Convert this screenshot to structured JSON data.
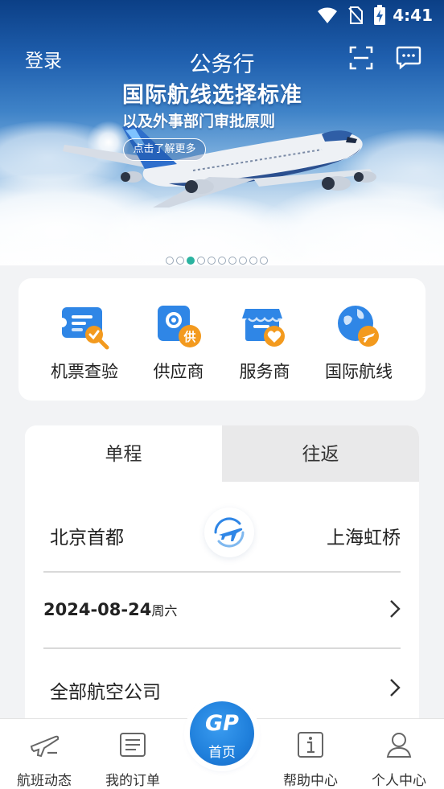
{
  "status_bar": {
    "time": "4:41"
  },
  "header": {
    "login_label": "登录",
    "title": "公务行"
  },
  "banner": {
    "title": "国际航线选择标准",
    "subtitle": "以及外事部门审批原则",
    "cta_label": "点击了解更多",
    "carousel_total": 10,
    "carousel_active_index": 2
  },
  "quick_services": [
    {
      "label": "机票查验",
      "icon": "ticket-verify-icon"
    },
    {
      "label": "供应商",
      "icon": "supplier-icon",
      "badge": "供"
    },
    {
      "label": "服务商",
      "icon": "service-provider-icon"
    },
    {
      "label": "国际航线",
      "icon": "international-route-icon"
    }
  ],
  "booking": {
    "tabs": [
      {
        "label": "单程",
        "selected": true
      },
      {
        "label": "往返",
        "selected": false
      }
    ],
    "from_city": "北京首都",
    "to_city": "上海虹桥",
    "date": "2024-08-24",
    "weekday": "周六",
    "airline": "全部航空公司"
  },
  "bottom_nav": {
    "items": [
      {
        "label": "航班动态",
        "icon": "flight-status-icon"
      },
      {
        "label": "我的订单",
        "icon": "orders-icon"
      },
      {
        "label": "帮助中心",
        "icon": "help-icon"
      },
      {
        "label": "个人中心",
        "icon": "profile-icon"
      }
    ],
    "home": {
      "logo": "GP",
      "label": "首页"
    }
  },
  "colors": {
    "primary_blue": "#1f7fdb",
    "accent_orange": "#f39a1e",
    "carousel_active": "#2bb3a0"
  }
}
